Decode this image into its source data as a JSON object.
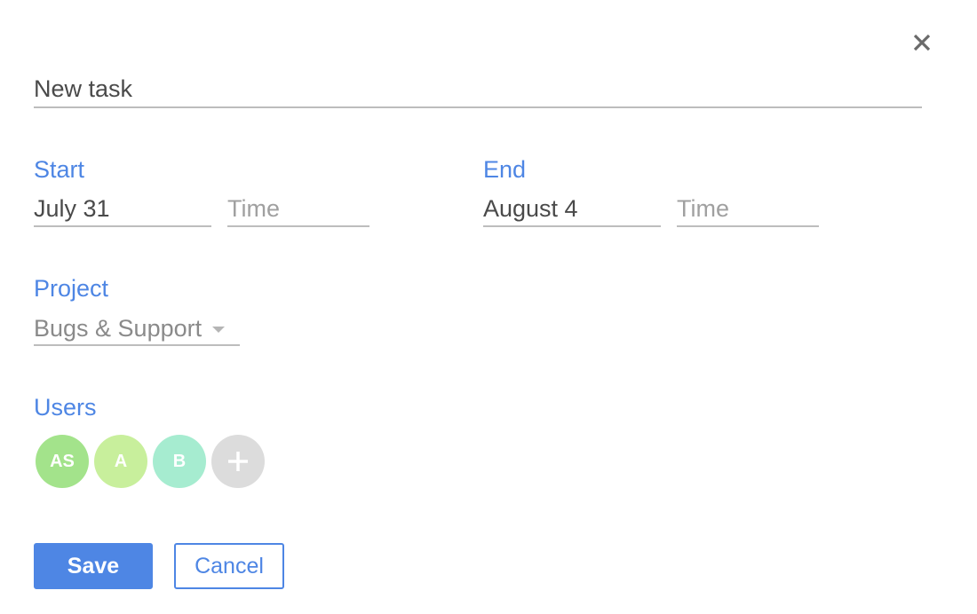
{
  "dialog": {
    "close_icon": "close-icon",
    "title_input": {
      "value": "New task",
      "placeholder": ""
    }
  },
  "start": {
    "label": "Start",
    "date": {
      "value": "July 31",
      "placeholder": ""
    },
    "time": {
      "value": "",
      "placeholder": "Time"
    }
  },
  "end": {
    "label": "End",
    "date": {
      "value": "August 4",
      "placeholder": ""
    },
    "time": {
      "value": "",
      "placeholder": "Time"
    }
  },
  "project": {
    "label": "Project",
    "selected": "Bugs & Support",
    "caret_icon": "caret-down-icon"
  },
  "users": {
    "label": "Users",
    "avatars": [
      {
        "initials": "AS",
        "color": "#a3e38b"
      },
      {
        "initials": "A",
        "color": "#c8ef9c"
      },
      {
        "initials": "B",
        "color": "#a6ecd0"
      }
    ],
    "add": {
      "icon": "plus-icon",
      "color": "#dcdcdc"
    }
  },
  "actions": {
    "save_label": "Save",
    "cancel_label": "Cancel"
  },
  "colors": {
    "accent": "#4e86e4",
    "text": "#4a4a4a",
    "placeholder": "#a0a0a0",
    "underline": "#bdbdbd"
  }
}
